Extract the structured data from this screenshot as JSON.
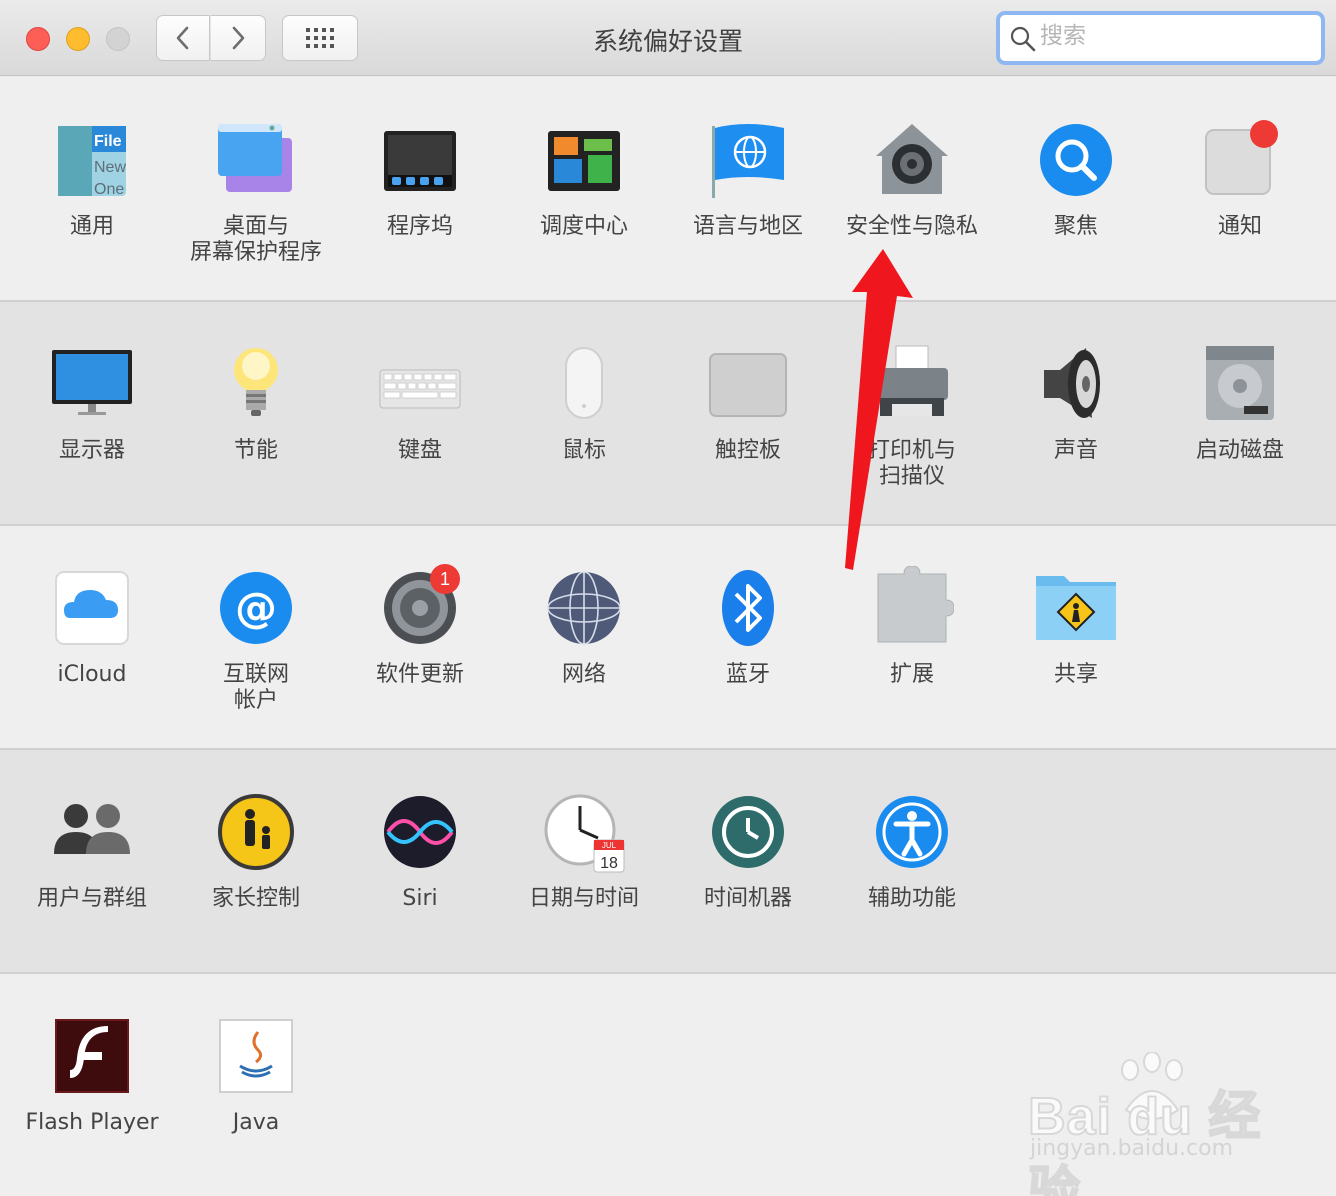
{
  "window": {
    "title": "系统偏好设置",
    "search_placeholder": "搜索"
  },
  "rows": [
    [
      {
        "label": "通用",
        "icon": "general-icon",
        "name": "pref-general"
      },
      {
        "label": "桌面与\n屏幕保护程序",
        "icon": "desktop-screensaver-icon",
        "name": "pref-desktop-screensaver"
      },
      {
        "label": "程序坞",
        "icon": "dock-icon",
        "name": "pref-dock"
      },
      {
        "label": "调度中心",
        "icon": "mission-control-icon",
        "name": "pref-mission-control"
      },
      {
        "label": "语言与地区",
        "icon": "language-region-icon",
        "name": "pref-language-region"
      },
      {
        "label": "安全性与隐私",
        "icon": "security-privacy-icon",
        "name": "pref-security-privacy"
      },
      {
        "label": "聚焦",
        "icon": "spotlight-icon",
        "name": "pref-spotlight"
      },
      {
        "label": "通知",
        "icon": "notifications-icon",
        "name": "pref-notifications"
      }
    ],
    [
      {
        "label": "显示器",
        "icon": "displays-icon",
        "name": "pref-displays"
      },
      {
        "label": "节能",
        "icon": "energy-saver-icon",
        "name": "pref-energy-saver"
      },
      {
        "label": "键盘",
        "icon": "keyboard-icon",
        "name": "pref-keyboard"
      },
      {
        "label": "鼠标",
        "icon": "mouse-icon",
        "name": "pref-mouse"
      },
      {
        "label": "触控板",
        "icon": "trackpad-icon",
        "name": "pref-trackpad"
      },
      {
        "label": "打印机与\n扫描仪",
        "icon": "printer-scanner-icon",
        "name": "pref-printers-scanners"
      },
      {
        "label": "声音",
        "icon": "sound-icon",
        "name": "pref-sound"
      },
      {
        "label": "启动磁盘",
        "icon": "startup-disk-icon",
        "name": "pref-startup-disk"
      }
    ],
    [
      {
        "label": "iCloud",
        "icon": "icloud-icon",
        "name": "pref-icloud"
      },
      {
        "label": "互联网\n帐户",
        "icon": "internet-accounts-icon",
        "name": "pref-internet-accounts"
      },
      {
        "label": "软件更新",
        "icon": "software-update-icon",
        "name": "pref-software-update",
        "badge": "1"
      },
      {
        "label": "网络",
        "icon": "network-icon",
        "name": "pref-network"
      },
      {
        "label": "蓝牙",
        "icon": "bluetooth-icon",
        "name": "pref-bluetooth"
      },
      {
        "label": "扩展",
        "icon": "extensions-icon",
        "name": "pref-extensions"
      },
      {
        "label": "共享",
        "icon": "sharing-icon",
        "name": "pref-sharing"
      }
    ],
    [
      {
        "label": "用户与群组",
        "icon": "users-groups-icon",
        "name": "pref-users-groups"
      },
      {
        "label": "家长控制",
        "icon": "parental-controls-icon",
        "name": "pref-parental-controls"
      },
      {
        "label": "Siri",
        "icon": "siri-icon",
        "name": "pref-siri"
      },
      {
        "label": "日期与时间",
        "icon": "date-time-icon",
        "name": "pref-date-time"
      },
      {
        "label": "时间机器",
        "icon": "time-machine-icon",
        "name": "pref-time-machine"
      },
      {
        "label": "辅助功能",
        "icon": "accessibility-icon",
        "name": "pref-accessibility"
      }
    ],
    [
      {
        "label": "Flash Player",
        "icon": "flash-player-icon",
        "name": "pref-flash-player"
      },
      {
        "label": "Java",
        "icon": "java-icon",
        "name": "pref-java"
      }
    ]
  ],
  "icon_text": {
    "general": [
      "File",
      "New",
      "One"
    ],
    "calendar_month": "JUL",
    "calendar_day": "18"
  },
  "watermark": {
    "brand": "Bai du 经验",
    "url": "jingyan.baidu.com"
  },
  "colors": {
    "annotation_arrow": "#f0161e",
    "close": "#fd5f57",
    "minimize": "#febc2e",
    "search_focus": "#8fb7f1"
  }
}
